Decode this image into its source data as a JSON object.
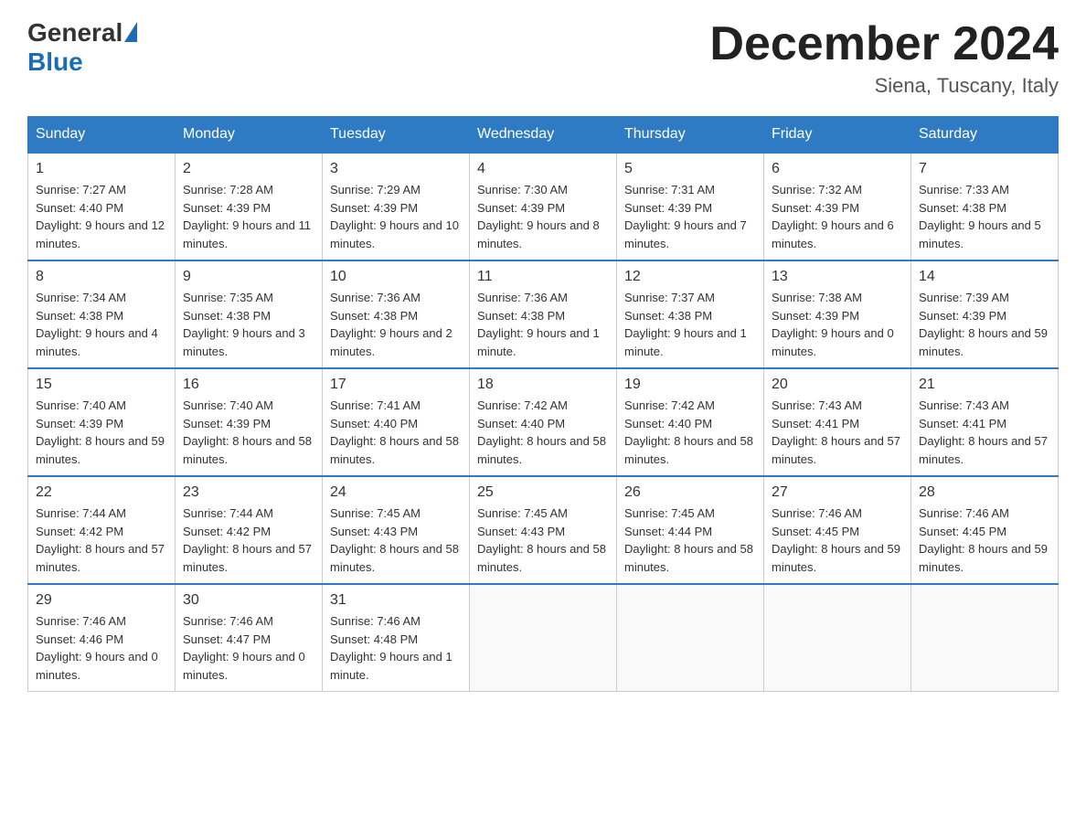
{
  "header": {
    "logo_general": "General",
    "logo_blue": "Blue",
    "month_title": "December 2024",
    "location": "Siena, Tuscany, Italy"
  },
  "days_of_week": [
    "Sunday",
    "Monday",
    "Tuesday",
    "Wednesday",
    "Thursday",
    "Friday",
    "Saturday"
  ],
  "weeks": [
    [
      {
        "day": "1",
        "sunrise": "7:27 AM",
        "sunset": "4:40 PM",
        "daylight": "9 hours and 12 minutes."
      },
      {
        "day": "2",
        "sunrise": "7:28 AM",
        "sunset": "4:39 PM",
        "daylight": "9 hours and 11 minutes."
      },
      {
        "day": "3",
        "sunrise": "7:29 AM",
        "sunset": "4:39 PM",
        "daylight": "9 hours and 10 minutes."
      },
      {
        "day": "4",
        "sunrise": "7:30 AM",
        "sunset": "4:39 PM",
        "daylight": "9 hours and 8 minutes."
      },
      {
        "day": "5",
        "sunrise": "7:31 AM",
        "sunset": "4:39 PM",
        "daylight": "9 hours and 7 minutes."
      },
      {
        "day": "6",
        "sunrise": "7:32 AM",
        "sunset": "4:39 PM",
        "daylight": "9 hours and 6 minutes."
      },
      {
        "day": "7",
        "sunrise": "7:33 AM",
        "sunset": "4:38 PM",
        "daylight": "9 hours and 5 minutes."
      }
    ],
    [
      {
        "day": "8",
        "sunrise": "7:34 AM",
        "sunset": "4:38 PM",
        "daylight": "9 hours and 4 minutes."
      },
      {
        "day": "9",
        "sunrise": "7:35 AM",
        "sunset": "4:38 PM",
        "daylight": "9 hours and 3 minutes."
      },
      {
        "day": "10",
        "sunrise": "7:36 AM",
        "sunset": "4:38 PM",
        "daylight": "9 hours and 2 minutes."
      },
      {
        "day": "11",
        "sunrise": "7:36 AM",
        "sunset": "4:38 PM",
        "daylight": "9 hours and 1 minute."
      },
      {
        "day": "12",
        "sunrise": "7:37 AM",
        "sunset": "4:38 PM",
        "daylight": "9 hours and 1 minute."
      },
      {
        "day": "13",
        "sunrise": "7:38 AM",
        "sunset": "4:39 PM",
        "daylight": "9 hours and 0 minutes."
      },
      {
        "day": "14",
        "sunrise": "7:39 AM",
        "sunset": "4:39 PM",
        "daylight": "8 hours and 59 minutes."
      }
    ],
    [
      {
        "day": "15",
        "sunrise": "7:40 AM",
        "sunset": "4:39 PM",
        "daylight": "8 hours and 59 minutes."
      },
      {
        "day": "16",
        "sunrise": "7:40 AM",
        "sunset": "4:39 PM",
        "daylight": "8 hours and 58 minutes."
      },
      {
        "day": "17",
        "sunrise": "7:41 AM",
        "sunset": "4:40 PM",
        "daylight": "8 hours and 58 minutes."
      },
      {
        "day": "18",
        "sunrise": "7:42 AM",
        "sunset": "4:40 PM",
        "daylight": "8 hours and 58 minutes."
      },
      {
        "day": "19",
        "sunrise": "7:42 AM",
        "sunset": "4:40 PM",
        "daylight": "8 hours and 58 minutes."
      },
      {
        "day": "20",
        "sunrise": "7:43 AM",
        "sunset": "4:41 PM",
        "daylight": "8 hours and 57 minutes."
      },
      {
        "day": "21",
        "sunrise": "7:43 AM",
        "sunset": "4:41 PM",
        "daylight": "8 hours and 57 minutes."
      }
    ],
    [
      {
        "day": "22",
        "sunrise": "7:44 AM",
        "sunset": "4:42 PM",
        "daylight": "8 hours and 57 minutes."
      },
      {
        "day": "23",
        "sunrise": "7:44 AM",
        "sunset": "4:42 PM",
        "daylight": "8 hours and 57 minutes."
      },
      {
        "day": "24",
        "sunrise": "7:45 AM",
        "sunset": "4:43 PM",
        "daylight": "8 hours and 58 minutes."
      },
      {
        "day": "25",
        "sunrise": "7:45 AM",
        "sunset": "4:43 PM",
        "daylight": "8 hours and 58 minutes."
      },
      {
        "day": "26",
        "sunrise": "7:45 AM",
        "sunset": "4:44 PM",
        "daylight": "8 hours and 58 minutes."
      },
      {
        "day": "27",
        "sunrise": "7:46 AM",
        "sunset": "4:45 PM",
        "daylight": "8 hours and 59 minutes."
      },
      {
        "day": "28",
        "sunrise": "7:46 AM",
        "sunset": "4:45 PM",
        "daylight": "8 hours and 59 minutes."
      }
    ],
    [
      {
        "day": "29",
        "sunrise": "7:46 AM",
        "sunset": "4:46 PM",
        "daylight": "9 hours and 0 minutes."
      },
      {
        "day": "30",
        "sunrise": "7:46 AM",
        "sunset": "4:47 PM",
        "daylight": "9 hours and 0 minutes."
      },
      {
        "day": "31",
        "sunrise": "7:46 AM",
        "sunset": "4:48 PM",
        "daylight": "9 hours and 1 minute."
      },
      null,
      null,
      null,
      null
    ]
  ]
}
